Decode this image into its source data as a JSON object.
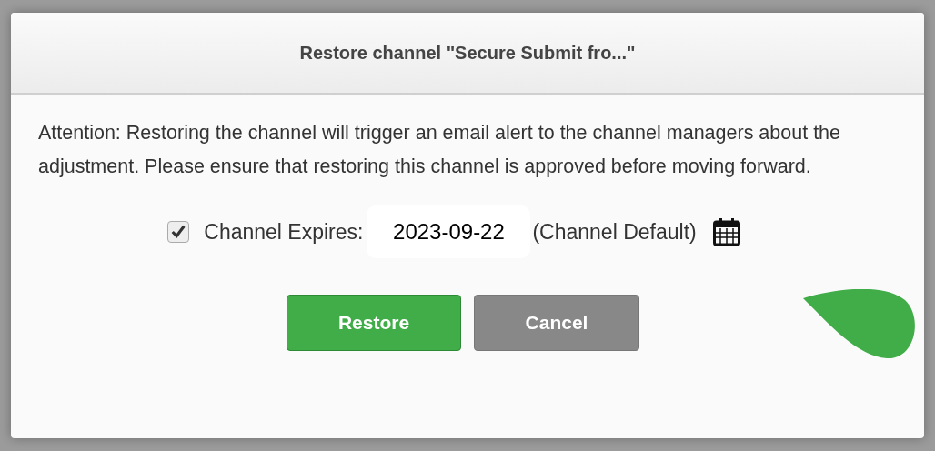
{
  "dialog": {
    "title": "Restore channel \"Secure Submit fro...\"",
    "message": "Attention: Restoring the channel will trigger an email alert to the channel managers about the adjustment. Please ensure that restoring this channel is approved before moving forward.",
    "expiry": {
      "checked": true,
      "label": "Channel Expires:",
      "value": "2023-09-22",
      "note": "(Channel Default)"
    },
    "buttons": [
      {
        "label": "Restore",
        "kind": "primary"
      },
      {
        "label": "Cancel",
        "kind": "secondary"
      }
    ]
  }
}
